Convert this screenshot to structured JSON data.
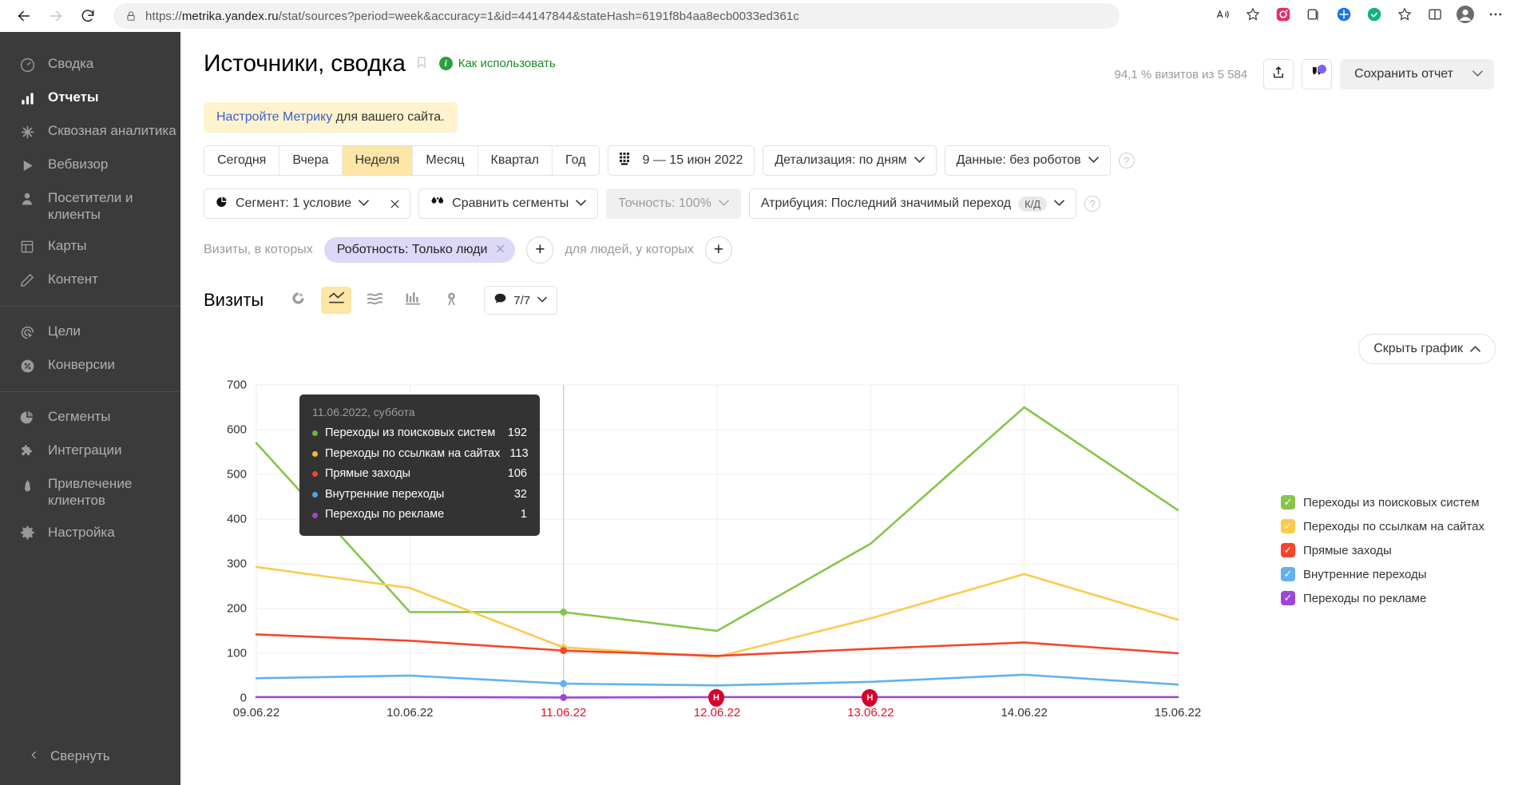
{
  "browser": {
    "url_prefix": "https://",
    "url_domain": "metrika.yandex.ru",
    "url_rest": "/stat/sources?period=week&accuracy=1&id=44147844&stateHash=6191f8b4aa8ecb0033ed361c",
    "back_icon": "back-arrow-icon",
    "forward_icon": "forward-arrow-icon",
    "reload_icon": "reload-icon",
    "lock_icon": "lock-icon"
  },
  "sidebar": {
    "groups": [
      {
        "items": [
          {
            "label": "Сводка",
            "icon": "dashboard-icon",
            "active": false
          },
          {
            "label": "Отчеты",
            "icon": "bar-chart-icon",
            "active": true
          },
          {
            "label": "Сквозная аналитика",
            "icon": "snowflake-icon",
            "active": false
          },
          {
            "label": "Вебвизор",
            "icon": "play-icon",
            "active": false
          },
          {
            "label": "Посетители и клиенты",
            "icon": "person-icon",
            "active": false
          },
          {
            "label": "Карты",
            "icon": "layout-icon",
            "active": false
          },
          {
            "label": "Контент",
            "icon": "pencil-icon",
            "active": false
          }
        ]
      },
      {
        "items": [
          {
            "label": "Цели",
            "icon": "target-icon",
            "active": false
          },
          {
            "label": "Конверсии",
            "icon": "percent-icon",
            "active": false
          }
        ]
      },
      {
        "items": [
          {
            "label": "Сегменты",
            "icon": "pie-icon",
            "active": false
          },
          {
            "label": "Интеграции",
            "icon": "puzzle-icon",
            "active": false
          },
          {
            "label": "Привлечение клиентов",
            "icon": "flame-icon",
            "active": false
          },
          {
            "label": "Настройка",
            "icon": "gear-icon",
            "active": false
          }
        ]
      }
    ],
    "collapse_label": "Свернуть"
  },
  "header": {
    "title": "Источники, сводка",
    "howto_label": "Как использовать",
    "visits_stat": "94,1 % визитов из 5 584",
    "save_report_label": "Сохранить отчет",
    "share_icon": "share-icon",
    "comments_icon": "comments-icon",
    "bookmark_icon": "bookmark-icon"
  },
  "notice": {
    "link_text": "Настройте Метрику",
    "rest_text": " для вашего сайта."
  },
  "toolbar": {
    "periods": [
      {
        "label": "Сегодня",
        "active": false
      },
      {
        "label": "Вчера",
        "active": false
      },
      {
        "label": "Неделя",
        "active": true
      },
      {
        "label": "Месяц",
        "active": false
      },
      {
        "label": "Квартал",
        "active": false
      },
      {
        "label": "Год",
        "active": false
      }
    ],
    "date_range": "9 — 15 июн 2022",
    "calendar_icon": "calendar-icon",
    "detail_label": "Детализация: по дням",
    "data_label": "Данные: без роботов",
    "segment_label": "Сегмент: 1 условие",
    "compare_label": "Сравнить сегменты",
    "accuracy_label": "Точность: 100%",
    "attribution_label": "Атрибуция: Последний значимый переход",
    "attribution_badge": "К/Д"
  },
  "filters": {
    "visits_prefix": "Визиты, в которых",
    "chip_label": "Роботность: Только люди",
    "people_prefix": "для людей, у которых",
    "add_label": "+"
  },
  "chart_controls": {
    "title": "Визиты",
    "views": [
      {
        "icon": "donut-chart-icon",
        "active": false
      },
      {
        "icon": "line-chart-icon",
        "active": true
      },
      {
        "icon": "stacked-area-icon",
        "active": false
      },
      {
        "icon": "bar-chart-icon",
        "active": false
      },
      {
        "icon": "map-pin-icon",
        "active": false
      }
    ],
    "count_label": "7/7",
    "speech_icon": "speech-bubble-icon",
    "hide_chart_label": "Скрыть график"
  },
  "tooltip": {
    "date": "11.06.2022, суббота",
    "rows": [
      {
        "name": "Переходы из поисковых систем",
        "value": "192",
        "color": "#6ab43e"
      },
      {
        "name": "Переходы по ссылкам на сайтах",
        "value": "113",
        "color": "#f5bc26"
      },
      {
        "name": "Прямые заходы",
        "value": "106",
        "color": "#ef4a23"
      },
      {
        "name": "Внутренние переходы",
        "value": "32",
        "color": "#4aa5e8"
      },
      {
        "name": "Переходы по рекламе",
        "value": "1",
        "color": "#a347c9"
      }
    ]
  },
  "legend": {
    "items": [
      {
        "label": "Переходы из поисковых систем",
        "color": "#86c54a",
        "checked": true
      },
      {
        "label": "Переходы по ссылкам на сайтах",
        "color": "#fccb4b",
        "checked": true
      },
      {
        "label": "Прямые заходы",
        "color": "#f5452c",
        "checked": true
      },
      {
        "label": "Внутренние переходы",
        "color": "#62b2ef",
        "checked": true
      },
      {
        "label": "Переходы по рекламе",
        "color": "#9c47d8",
        "checked": true
      }
    ],
    "check_glyph": "✓"
  },
  "chart_data": {
    "type": "line",
    "title": "Визиты",
    "xlabel": "",
    "ylabel": "",
    "ylim": [
      0,
      700
    ],
    "yticks": [
      0,
      100,
      200,
      300,
      400,
      500,
      600,
      700
    ],
    "grid": true,
    "legend_position": "right",
    "categories": [
      "09.06.22",
      "10.06.22",
      "11.06.22",
      "12.06.22",
      "13.06.22",
      "14.06.22",
      "15.06.22"
    ],
    "holidays": [
      "11.06.22",
      "12.06.22",
      "13.06.22"
    ],
    "holiday_markers": [
      "12.06.22",
      "13.06.22"
    ],
    "holiday_marker_glyph": "H",
    "highlighted_category": "11.06.22",
    "series": [
      {
        "name": "Переходы из поисковых систем",
        "color": "#86c54a",
        "values": [
          570,
          192,
          192,
          150,
          345,
          650,
          420
        ]
      },
      {
        "name": "Переходы по ссылкам на сайтах",
        "color": "#fccb4b",
        "values": [
          293,
          246,
          113,
          92,
          178,
          277,
          175
        ]
      },
      {
        "name": "Прямые заходы",
        "color": "#f5452c",
        "values": [
          142,
          128,
          106,
          94,
          110,
          124,
          100
        ]
      },
      {
        "name": "Внутренние переходы",
        "color": "#62b2ef",
        "values": [
          44,
          50,
          32,
          28,
          36,
          52,
          30
        ]
      },
      {
        "name": "Переходы по рекламе",
        "color": "#9c47d8",
        "values": [
          2,
          2,
          1,
          2,
          2,
          2,
          2
        ]
      }
    ]
  }
}
